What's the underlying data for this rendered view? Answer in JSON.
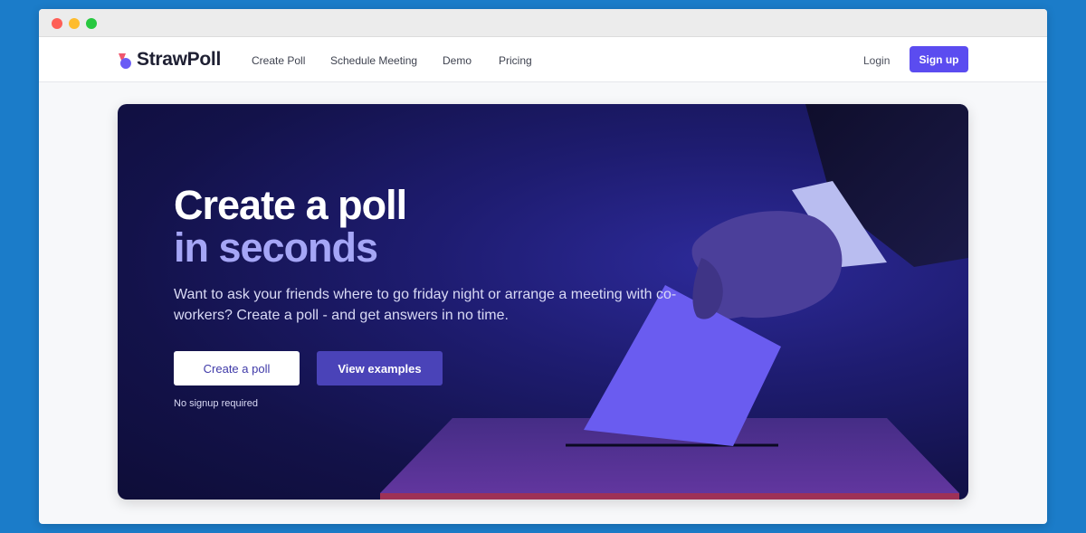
{
  "brand": {
    "name": "StrawPoll"
  },
  "nav": {
    "links": [
      "Create Poll",
      "Schedule Meeting",
      "Demo",
      "Pricing"
    ],
    "login": "Login",
    "signup": "Sign up"
  },
  "hero": {
    "title_line1": "Create a poll",
    "title_line2": "in seconds",
    "subtitle": "Want to ask your friends where to go friday night or arrange a meeting with co-workers? Create a poll - and get answers in no time.",
    "primary_button": "Create a poll",
    "secondary_button": "View examples",
    "note": "No signup required"
  },
  "colors": {
    "accent": "#5b4cf0",
    "hero_bg": "#13124a",
    "title_highlight": "#a5a6f6",
    "desktop_bg": "#1b7cc9"
  },
  "icons": {
    "logo": "strawpoll-logo-icon"
  }
}
